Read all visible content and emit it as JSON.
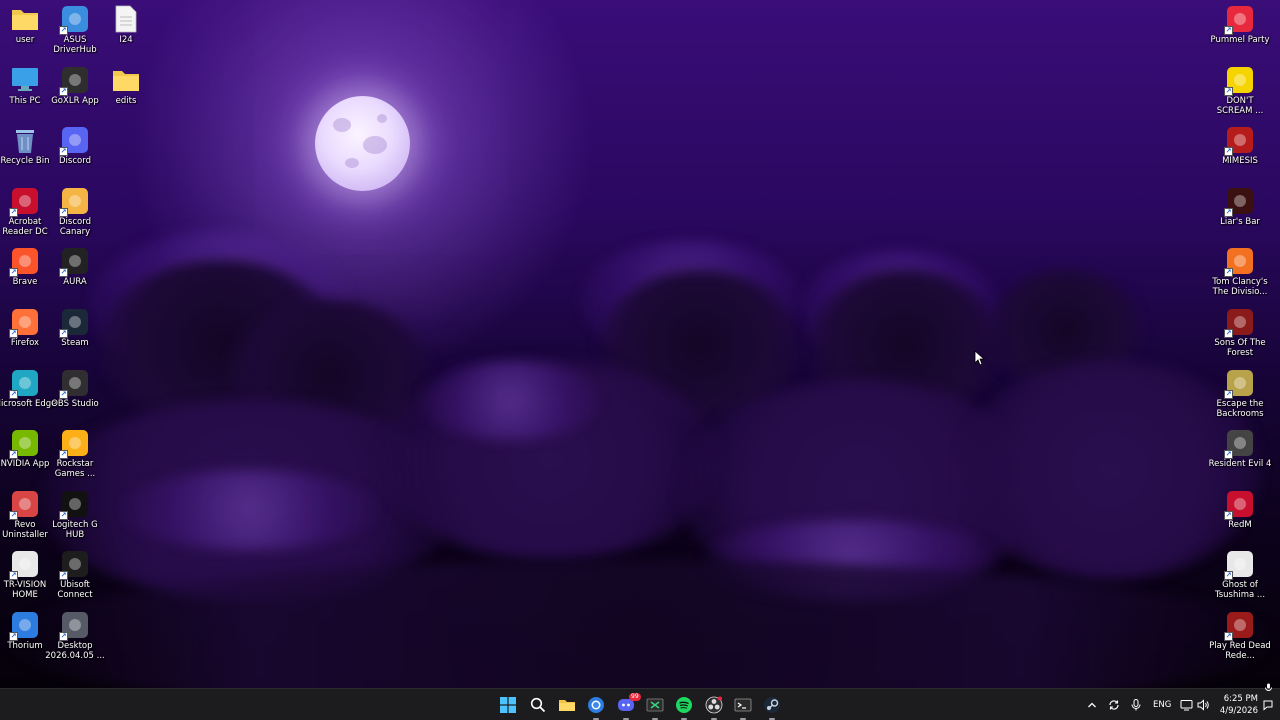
{
  "desktop": {
    "left_column_1": [
      {
        "label": "user",
        "icon": "folder-icon",
        "color": "#f2c94c"
      },
      {
        "label": "This PC",
        "icon": "monitor-icon",
        "color": "#3aa0e8"
      },
      {
        "label": "Recycle Bin",
        "icon": "recycle-bin-icon",
        "color": "#7aa8d8"
      },
      {
        "label": "Acrobat Reader DC",
        "icon": "acrobat-icon",
        "color": "#c8102e"
      },
      {
        "label": "Brave",
        "icon": "brave-icon",
        "color": "#fb542b"
      },
      {
        "label": "Firefox",
        "icon": "firefox-icon",
        "color": "#ff7139"
      },
      {
        "label": "Microsoft Edge",
        "icon": "edge-icon",
        "color": "#1fa7c4"
      },
      {
        "label": "NVIDIA App",
        "icon": "nvidia-icon",
        "color": "#76b900"
      },
      {
        "label": "Revo Uninstaller",
        "icon": "revo-icon",
        "color": "#d94545"
      },
      {
        "label": "TR-VISION HOME",
        "icon": "trvision-icon",
        "color": "#e8e8e8"
      },
      {
        "label": "Thorium",
        "icon": "thorium-icon",
        "color": "#2d7de0"
      }
    ],
    "left_column_2": [
      {
        "label": "ASUS DriverHub",
        "icon": "gear-icon",
        "color": "#3b8de0"
      },
      {
        "label": "GoXLR App",
        "icon": "goxlr-icon",
        "color": "#2e2e2e"
      },
      {
        "label": "Discord",
        "icon": "discord-icon",
        "color": "#5865f2"
      },
      {
        "label": "Discord Canary",
        "icon": "discord-canary-icon",
        "color": "#f5b544"
      },
      {
        "label": "AURA",
        "icon": "aura-icon",
        "color": "#222222"
      },
      {
        "label": "Steam",
        "icon": "steam-icon",
        "color": "#1b2838"
      },
      {
        "label": "OBS Studio",
        "icon": "obs-icon",
        "color": "#302e31"
      },
      {
        "label": "Rockstar Games ...",
        "icon": "rockstar-icon",
        "color": "#fcaf17"
      },
      {
        "label": "Logitech G HUB",
        "icon": "logitech-icon",
        "color": "#111111"
      },
      {
        "label": "Ubisoft Connect",
        "icon": "ubisoft-icon",
        "color": "#1d1d1d"
      },
      {
        "label": "Desktop 2026.04.05 ...",
        "icon": "video-file-icon",
        "color": "#555a66"
      }
    ],
    "left_column_3": [
      {
        "label": "I24",
        "icon": "document-icon",
        "color": "#f4f4f4"
      },
      {
        "label": "edits",
        "icon": "folder-icon",
        "color": "#f2c94c"
      }
    ],
    "right_column": [
      {
        "label": "Pummel Party",
        "icon": "pummel-party-icon",
        "color": "#e8283c"
      },
      {
        "label": "DON'T SCREAM ...",
        "icon": "dont-scream-icon",
        "color": "#f5d400"
      },
      {
        "label": "MIMESIS",
        "icon": "mimesis-icon",
        "color": "#b71c1c"
      },
      {
        "label": "Liar's Bar",
        "icon": "liars-bar-icon",
        "color": "#3a1010"
      },
      {
        "label": "Tom Clancy's The Divisio...",
        "icon": "division-icon",
        "color": "#f37021"
      },
      {
        "label": "Sons Of The Forest",
        "icon": "sons-forest-icon",
        "color": "#8b1a1a"
      },
      {
        "label": "Escape the Backrooms",
        "icon": "backrooms-icon",
        "color": "#b8a24a"
      },
      {
        "label": "Resident Evil 4",
        "icon": "re4-icon",
        "color": "#444444"
      },
      {
        "label": "RedM",
        "icon": "redm-icon",
        "color": "#c8102e"
      },
      {
        "label": "Ghost of Tsushima ...",
        "icon": "ghost-tsushima-icon",
        "color": "#e8e8e8"
      },
      {
        "label": "Play Red Dead Rede...",
        "icon": "rdr-icon",
        "color": "#9b1b1b"
      }
    ]
  },
  "taskbar": {
    "apps": [
      {
        "name": "start",
        "icon": "windows-start-icon"
      },
      {
        "name": "search",
        "icon": "search-icon"
      },
      {
        "name": "file-explorer",
        "icon": "folder-icon"
      },
      {
        "name": "thorium",
        "icon": "thorium-icon"
      },
      {
        "name": "discord",
        "icon": "discord-icon",
        "badge": "99"
      },
      {
        "name": "goxlr",
        "icon": "goxlr-icon"
      },
      {
        "name": "spotify",
        "icon": "spotify-icon"
      },
      {
        "name": "obs",
        "icon": "obs-icon"
      },
      {
        "name": "terminal",
        "icon": "terminal-icon"
      },
      {
        "name": "steam",
        "icon": "steam-icon"
      }
    ],
    "tray": {
      "language": "ENG",
      "time": "6:25 PM",
      "date": "4/9/2026"
    }
  }
}
